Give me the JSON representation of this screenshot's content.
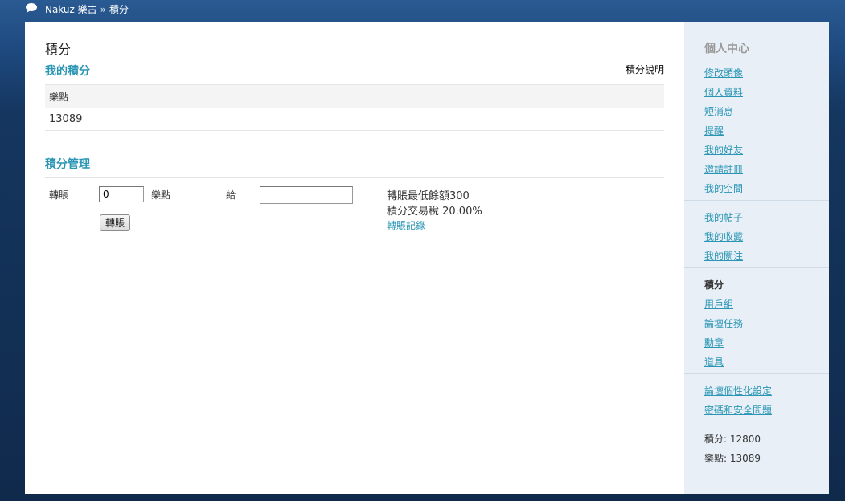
{
  "topbar": {
    "site": "Nakuz 樂古",
    "separator": "»",
    "current": "積分"
  },
  "main": {
    "page_title": "積分",
    "my_credits": {
      "title": "我的積分",
      "help_link": "積分說明",
      "column_header": "樂點",
      "value": "13089"
    },
    "manage": {
      "title": "積分管理",
      "transfer_label": "轉賬",
      "amount_value": "0",
      "unit_label": "樂點",
      "to_label": "給",
      "recipient_value": "",
      "submit_label": "轉賬",
      "min_balance": "轉賬最低餘額300",
      "tax": "積分交易稅 20.00%",
      "history_link": "轉賬記錄"
    }
  },
  "sidebar": {
    "title": "個人中心",
    "group1": [
      "修改頭像",
      "個人資料",
      "短消息",
      "提醒",
      "我的好友",
      "邀請註冊",
      "我的空間"
    ],
    "group2": [
      "我的帖子",
      "我的收藏",
      "我的關注"
    ],
    "group3": [
      "積分",
      "用戶組",
      "論壇任務",
      "勳章",
      "道具"
    ],
    "group4": [
      "論壇個性化設定",
      "密碼和安全問題"
    ],
    "stats": [
      "積分: 12800",
      "樂點: 13089"
    ]
  },
  "colors": {
    "accent": "#2a96b4",
    "sidebar_bg": "#e8eff7",
    "page_bg": "#15365f"
  }
}
